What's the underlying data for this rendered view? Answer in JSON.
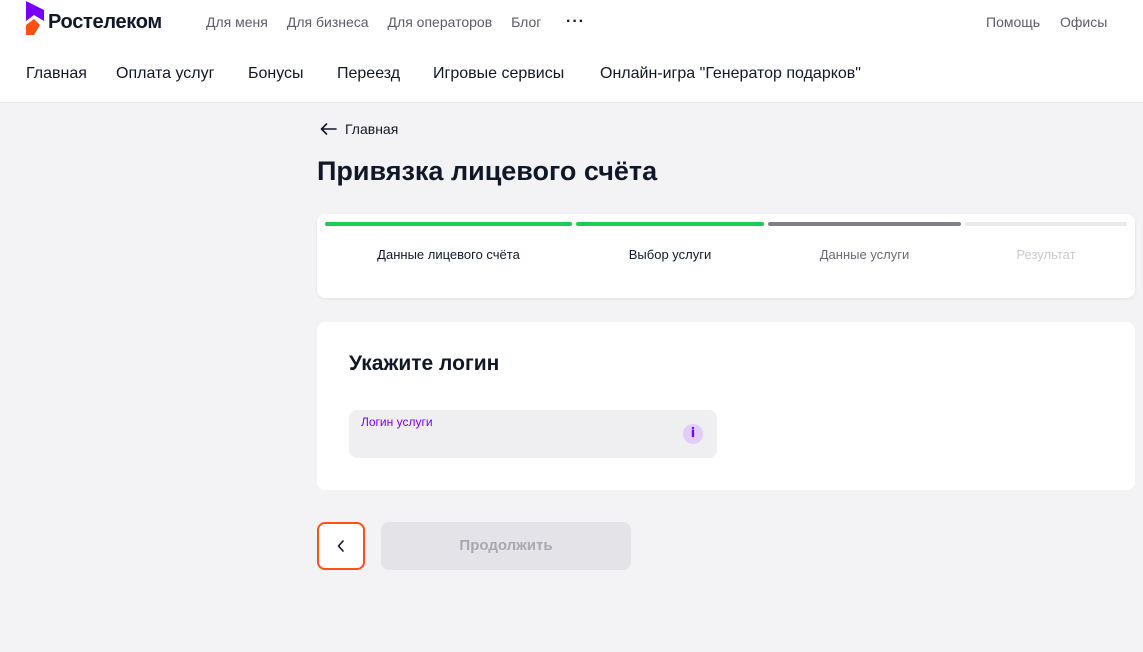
{
  "header": {
    "logo_text": "Ростелеком",
    "top_links": [
      "Для меня",
      "Для бизнеса",
      "Для операторов",
      "Блог"
    ],
    "more_label": "···",
    "help_label": "Помощь",
    "offices_label": "Офисы"
  },
  "main_nav": [
    "Главная",
    "Оплата услуг",
    "Бонусы",
    "Переезд",
    "Игровые сервисы",
    "Онлайн-игра \"Генератор подарков\""
  ],
  "breadcrumb": {
    "back_label": "Главная"
  },
  "page": {
    "title": "Привязка лицевого счёта"
  },
  "stepper": {
    "steps": [
      {
        "label": "Данные лицевого счёта",
        "status": "done"
      },
      {
        "label": "Выбор услуги",
        "status": "done"
      },
      {
        "label": "Данные услуги",
        "status": "current"
      },
      {
        "label": "Результат",
        "status": "pending"
      }
    ]
  },
  "form": {
    "title": "Укажите логин",
    "login_label": "Логин услуги",
    "login_value": "",
    "info_icon": "i"
  },
  "actions": {
    "continue_label": "Продолжить"
  },
  "colors": {
    "brand_purple": "#7700ff",
    "brand_orange": "#ff4f12",
    "step_done": "#19cc58",
    "step_current": "#7f8189",
    "step_pending": "#ebebee"
  }
}
